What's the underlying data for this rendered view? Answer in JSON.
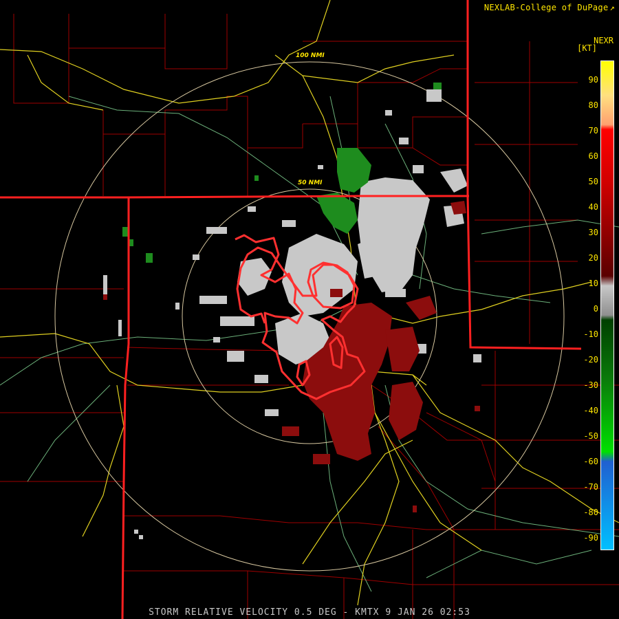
{
  "credit": "NEXLAB-College of DuPage",
  "product_code": "NEXR",
  "unit": "[KT]",
  "ring_labels": {
    "outer": "100 NMI",
    "inner": "50 NMI"
  },
  "scale_ticks": [
    "90",
    "80",
    "70",
    "60",
    "50",
    "40",
    "30",
    "20",
    "10",
    "0",
    "-10",
    "-20",
    "-30",
    "-40",
    "-50",
    "-60",
    "-70",
    "-80",
    "-90"
  ],
  "footer": "STORM RELATIVE VELOCITY 0.5 DEG - KMTX 9 JAN 26 02:53",
  "colors": {
    "background": "#000000",
    "state_border": "#ff2020",
    "county_border": "#b00000",
    "highway": "#ffe600",
    "river": "#7fd090",
    "range_ring": "#d8c8a0",
    "warning_polygon": "#ff3030",
    "inbound_green": "#1e8c1e",
    "outbound_red": "#8c0d0d",
    "near_zero_gray": "#c8c8c8"
  },
  "icons": {
    "credit_link": "external-link-icon"
  }
}
